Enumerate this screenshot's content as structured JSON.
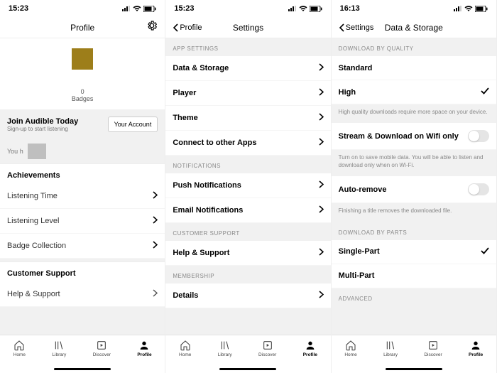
{
  "screen1": {
    "status_time": "15:23",
    "nav_title": "Profile",
    "badges_count": "0",
    "badges_label": "Badges",
    "join_title": "Join Audible Today",
    "join_sub": "Sign-up to start listening",
    "your_account_btn": "Your Account",
    "you_h": "You h",
    "achievements_hdr": "Achievements",
    "ach_items": [
      "Listening Time",
      "Listening Level",
      "Badge Collection"
    ],
    "support_hdr": "Customer Support",
    "support_item": "Help & Support"
  },
  "screen2": {
    "status_time": "15:23",
    "back_label": "Profile",
    "nav_title": "Settings",
    "sections": {
      "app": {
        "hdr": "APP SETTINGS",
        "items": [
          "Data & Storage",
          "Player",
          "Theme",
          "Connect to other Apps"
        ]
      },
      "notif": {
        "hdr": "NOTIFICATIONS",
        "items": [
          "Push Notifications",
          "Email Notifications"
        ]
      },
      "support": {
        "hdr": "CUSTOMER SUPPORT",
        "items": [
          "Help & Support"
        ]
      },
      "member": {
        "hdr": "MEMBERSHIP",
        "items": [
          "Details"
        ]
      }
    }
  },
  "screen3": {
    "status_time": "16:13",
    "back_label": "Settings",
    "nav_title": "Data & Storage",
    "quality_hdr": "DOWNLOAD BY QUALITY",
    "quality_items": [
      "Standard",
      "High"
    ],
    "quality_selected": "High",
    "quality_note": "High quality downloads require more space on your device.",
    "wifi_label": "Stream & Download on Wifi only",
    "wifi_note": "Turn on to save mobile data. You will be able to listen and download only when on Wi-Fi.",
    "autoremove_label": "Auto-remove",
    "autoremove_note": "Finishing a title removes the downloaded file.",
    "parts_hdr": "DOWNLOAD BY PARTS",
    "parts_items": [
      "Single-Part",
      "Multi-Part"
    ],
    "parts_selected": "Single-Part",
    "advanced_hdr": "ADVANCED"
  },
  "tabs": {
    "home": "Home",
    "library": "Library",
    "discover": "Discover",
    "profile": "Profile"
  }
}
